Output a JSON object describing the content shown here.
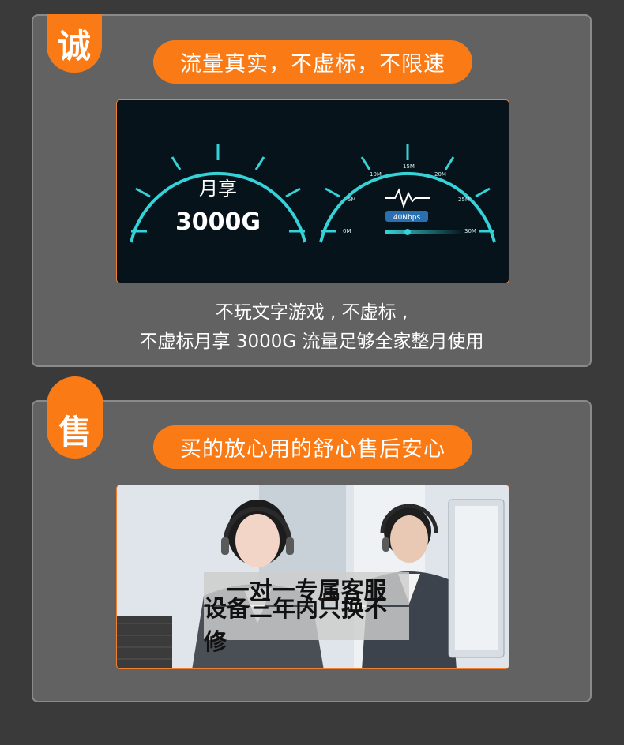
{
  "sections": [
    {
      "badge": "诚",
      "headline": "流量真实，不虚标，不限速",
      "gauge_left": {
        "line1": "月享",
        "line2": "3000G"
      },
      "gauge_right": {
        "ticks": [
          "0M",
          "5M",
          "10M",
          "15M",
          "20M",
          "25M",
          "30M"
        ],
        "readout": "40Nbps"
      },
      "caption_lines": [
        "不玩文字游戏 , 不虚标 ,",
        "不虚标月享 3000G 流量足够全家整月使用"
      ]
    },
    {
      "badge": "售",
      "headline": "买的放心用的舒心售后安心",
      "overlay_lines": [
        "一对一专属客服",
        "设备三年内只换不修"
      ]
    }
  ],
  "colors": {
    "accent": "#fa7a15",
    "gauge": "#35d2d8",
    "card": "#626262",
    "background": "#3a3a3a"
  }
}
